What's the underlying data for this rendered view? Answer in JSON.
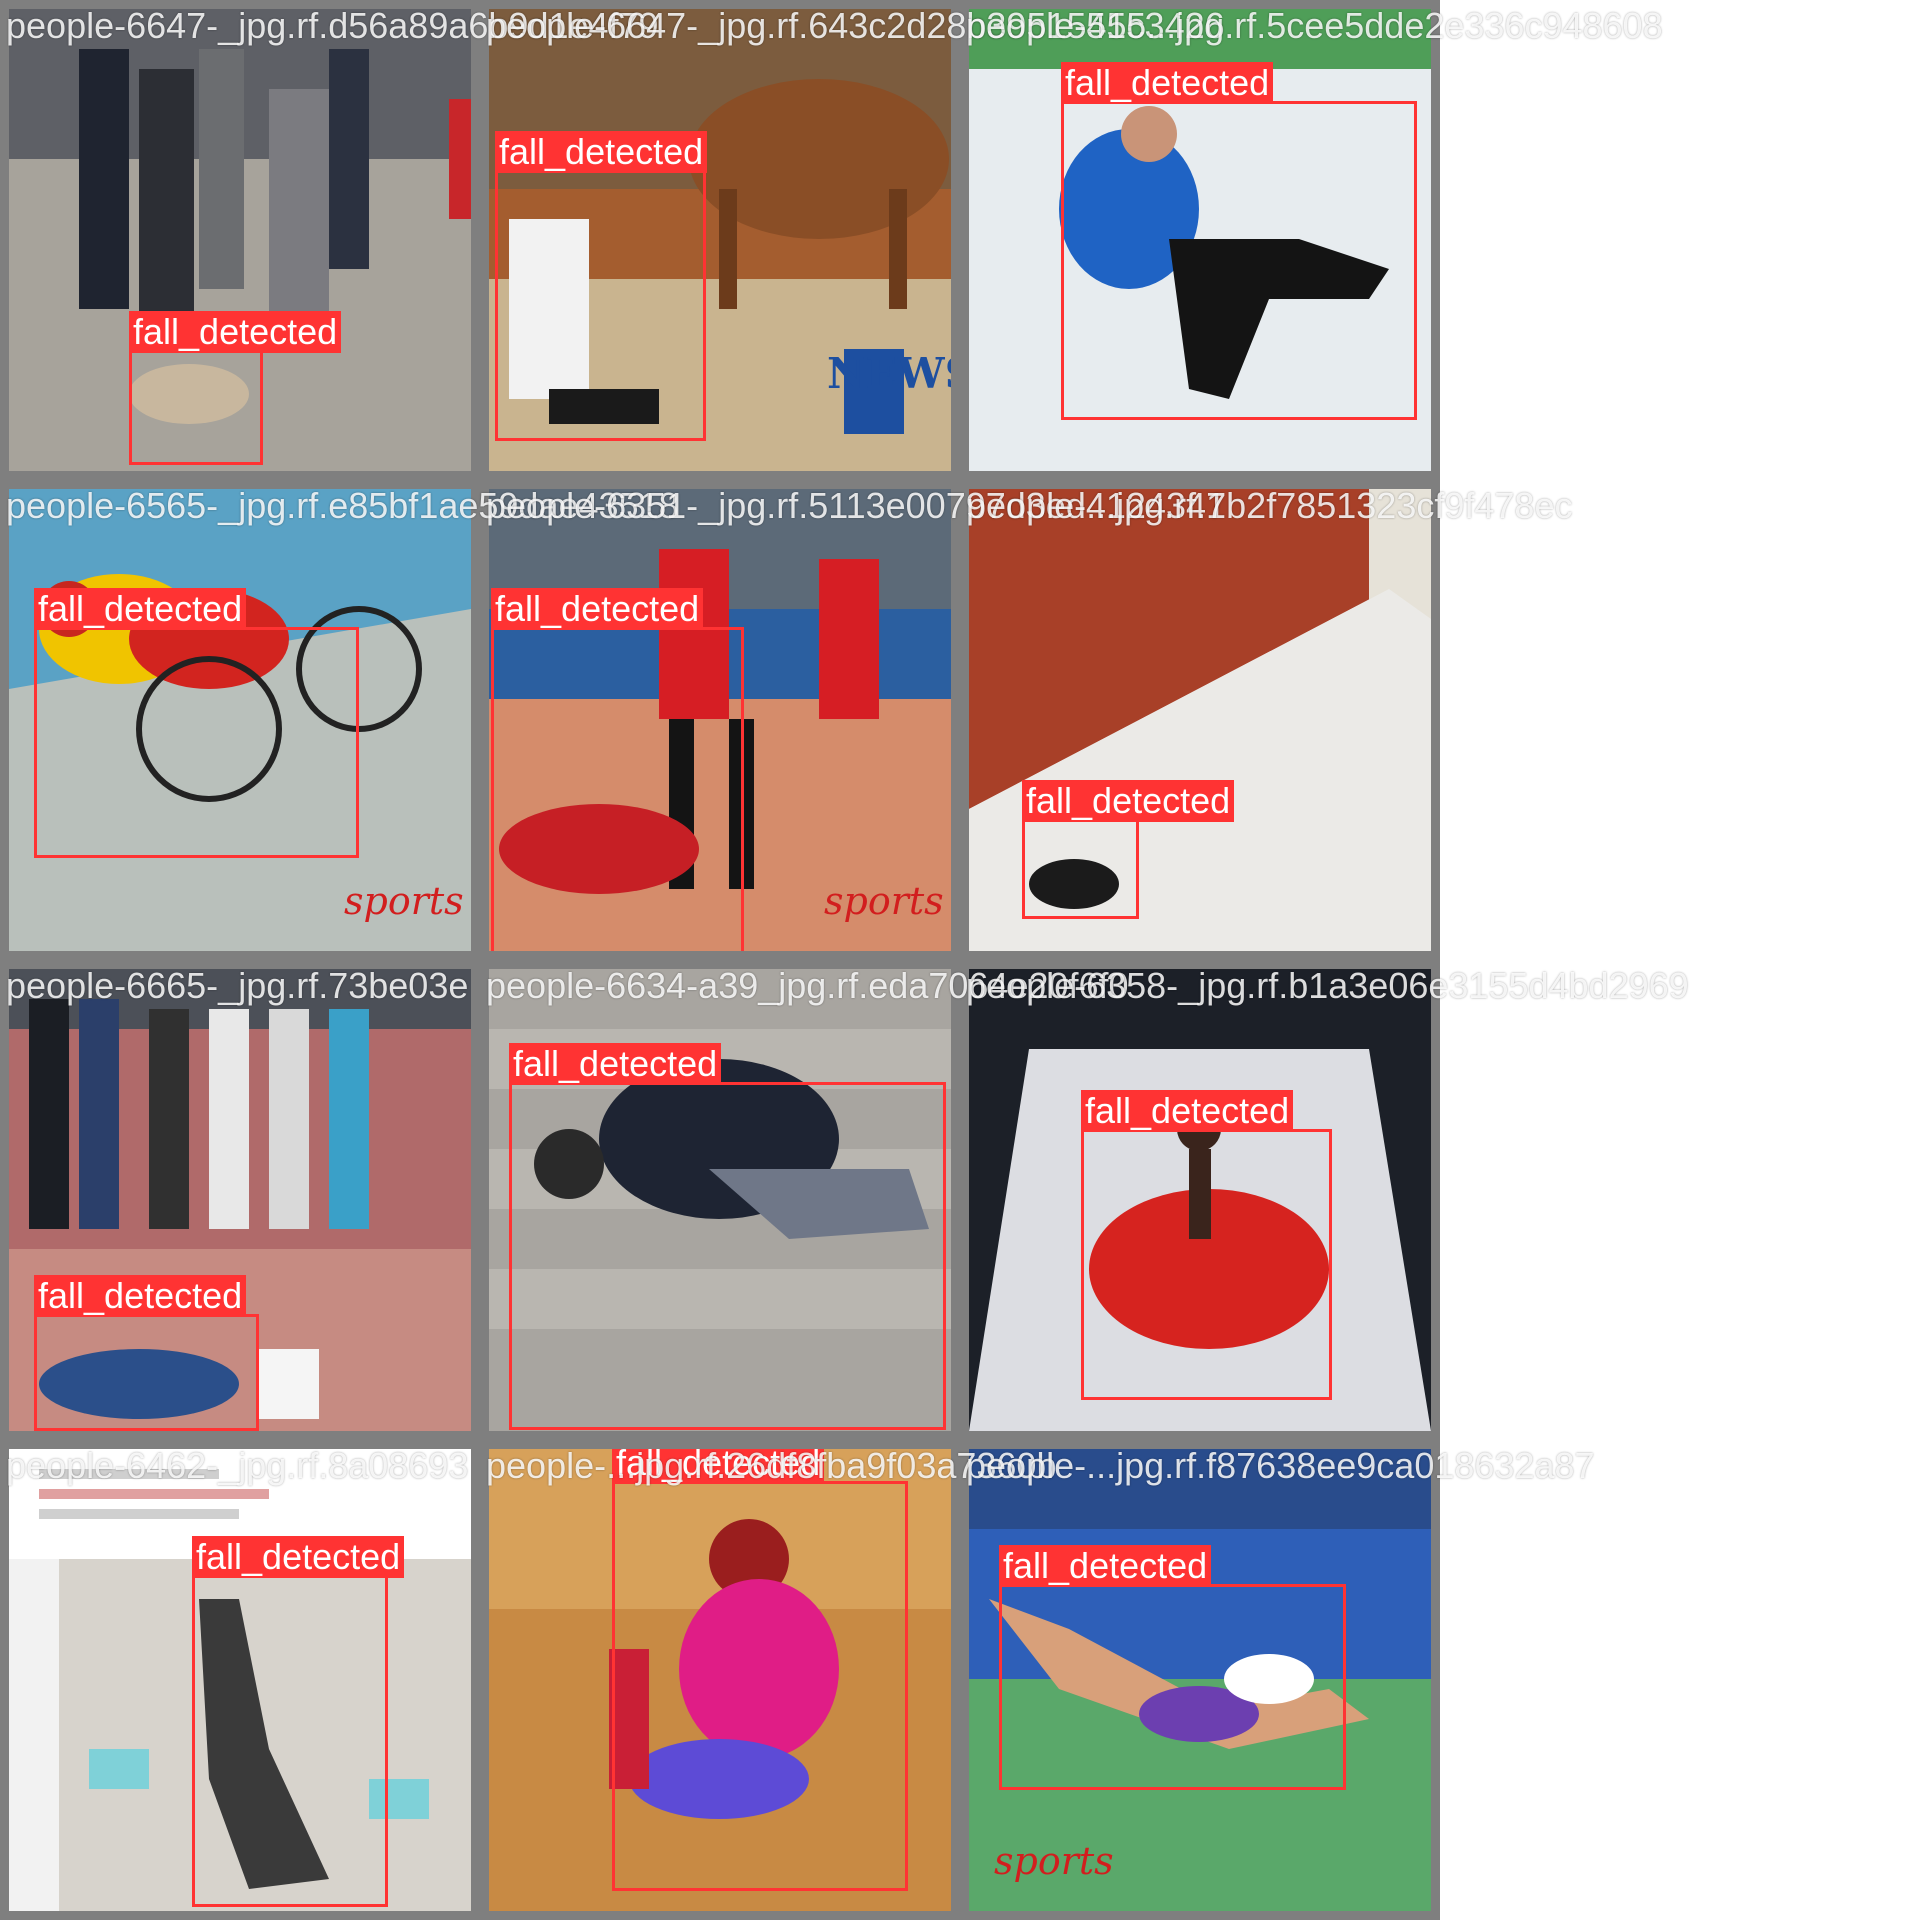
{
  "colors": {
    "box": "#ff3333",
    "label_text": "#ffffff",
    "tile_border": "#7f7f7f",
    "filename_text": "#ffffff"
  },
  "tiles": [
    {
      "filename": "people-6647-_jpg.rf.d56a89a6b9d1e4f79",
      "label": "fall_detected"
    },
    {
      "filename": "people-6647-_jpg.rf.643c2d28b3951545c3426",
      "label": "fall_detected"
    },
    {
      "filename": "people-515...jpg.rf.5cee5dde2e336c948608",
      "label": "fall_detected"
    },
    {
      "filename": "people-6565-_jpg.rf.e85bf1ae59dae43518",
      "label": "fall_detected"
    },
    {
      "filename": "people-6351-_jpg.rf.5113e00797d3ed4124341",
      "label": "fall_detected"
    },
    {
      "filename": "people-...jpg.rf.7b2f7851323cf9f478ec",
      "label": "fall_detected"
    },
    {
      "filename": "people-6665-_jpg.rf.73be03e",
      "label": "fall_detected"
    },
    {
      "filename": "people-6634-a39_jpg.rf.eda7064e20f6f0",
      "label": "fall_detected"
    },
    {
      "filename": "people-6358-_jpg.rf.b1a3e06e3155d4bd2969",
      "label": "fall_detected"
    },
    {
      "filename": "people-6462-_jpg.rf.8a08693",
      "label": "fall_detected"
    },
    {
      "filename": "people-...jpg.rf.26df8fba9f03a7360b",
      "label": "fall_detected"
    },
    {
      "filename": "people-...jpg.rf.f87638ee9ca018632a87",
      "label": "fall_detected"
    }
  ],
  "watermarks": {
    "news": "NEWS",
    "sports": "sports"
  }
}
